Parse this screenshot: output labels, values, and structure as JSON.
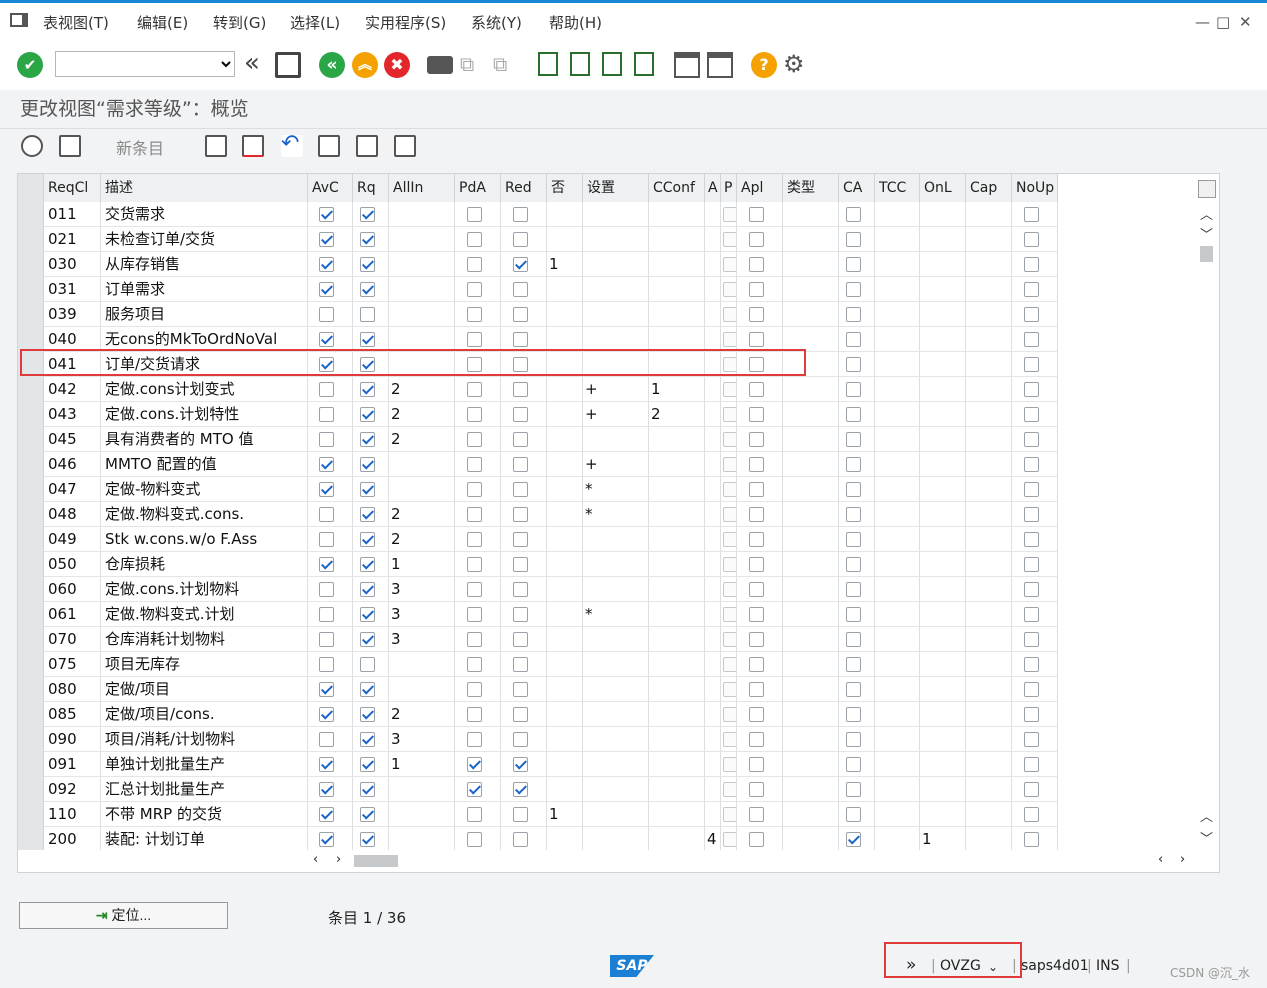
{
  "menu": {
    "items": [
      "表视图(T)",
      "编辑(E)",
      "转到(G)",
      "选择(L)",
      "实用程序(S)",
      "系统(Y)",
      "帮助(H)"
    ]
  },
  "window": {
    "minimize": "—",
    "maximize": "□",
    "close": "✕"
  },
  "title": "更改视图“需求等级”：概览",
  "app_toolbar": {
    "new_entries": "新条目"
  },
  "table": {
    "columns": [
      "ReqCl",
      "描述",
      "AvC",
      "Rq",
      "AllIn",
      "PdA",
      "Red",
      "否",
      "设置",
      "CConf",
      "A",
      "P",
      "Apl",
      "类型",
      "CA",
      "TCC",
      "OnL",
      "Cap",
      "NoUp"
    ],
    "rows": [
      {
        "reqcl": "011",
        "desc": "交货需求",
        "avc": true,
        "rq": true,
        "allin": "",
        "pda": false,
        "red": false,
        "no": "",
        "set": "",
        "cconf": "",
        "a": "",
        "p": false,
        "apl": false,
        "ca": false,
        "onl": "",
        "noup": false
      },
      {
        "reqcl": "021",
        "desc": "未检查订单/交货",
        "avc": true,
        "rq": true,
        "allin": "",
        "pda": false,
        "red": false,
        "no": "",
        "set": "",
        "cconf": "",
        "a": "",
        "p": false,
        "apl": false,
        "ca": false,
        "onl": "",
        "noup": false
      },
      {
        "reqcl": "030",
        "desc": "从库存销售",
        "avc": true,
        "rq": true,
        "allin": "",
        "pda": false,
        "red": true,
        "no": "1",
        "set": "",
        "cconf": "",
        "a": "",
        "p": false,
        "apl": false,
        "ca": false,
        "onl": "",
        "noup": false
      },
      {
        "reqcl": "031",
        "desc": "订单需求",
        "avc": true,
        "rq": true,
        "allin": "",
        "pda": false,
        "red": false,
        "no": "",
        "set": "",
        "cconf": "",
        "a": "",
        "p": false,
        "apl": false,
        "ca": false,
        "onl": "",
        "noup": false
      },
      {
        "reqcl": "039",
        "desc": "服务项目",
        "avc": false,
        "rq": false,
        "allin": "",
        "pda": false,
        "red": false,
        "no": "",
        "set": "",
        "cconf": "",
        "a": "",
        "p": false,
        "apl": false,
        "ca": false,
        "onl": "",
        "noup": false
      },
      {
        "reqcl": "040",
        "desc": "无cons的MkToOrdNoVal",
        "avc": true,
        "rq": true,
        "allin": "",
        "pda": false,
        "red": false,
        "no": "",
        "set": "",
        "cconf": "",
        "a": "",
        "p": false,
        "apl": false,
        "ca": false,
        "onl": "",
        "noup": false
      },
      {
        "reqcl": "041",
        "desc": "订单/交货请求",
        "avc": true,
        "rq": true,
        "allin": "",
        "pda": false,
        "red": false,
        "no": "",
        "set": "",
        "cconf": "",
        "a": "",
        "p": false,
        "apl": false,
        "ca": false,
        "onl": "",
        "noup": false
      },
      {
        "reqcl": "042",
        "desc": "定做.cons计划变式",
        "avc": false,
        "rq": true,
        "allin": "2",
        "pda": false,
        "red": false,
        "no": "",
        "set": "+",
        "cconf": "1",
        "a": "",
        "p": false,
        "apl": false,
        "ca": false,
        "onl": "",
        "noup": false
      },
      {
        "reqcl": "043",
        "desc": "定做.cons.计划特性",
        "avc": false,
        "rq": true,
        "allin": "2",
        "pda": false,
        "red": false,
        "no": "",
        "set": "+",
        "cconf": "2",
        "a": "",
        "p": false,
        "apl": false,
        "ca": false,
        "onl": "",
        "noup": false
      },
      {
        "reqcl": "045",
        "desc": "具有消费者的 MTO 值",
        "avc": false,
        "rq": true,
        "allin": "2",
        "pda": false,
        "red": false,
        "no": "",
        "set": "",
        "cconf": "",
        "a": "",
        "p": false,
        "apl": false,
        "ca": false,
        "onl": "",
        "noup": false
      },
      {
        "reqcl": "046",
        "desc": "MMTO 配置的值",
        "avc": true,
        "rq": true,
        "allin": "",
        "pda": false,
        "red": false,
        "no": "",
        "set": "+",
        "cconf": "",
        "a": "",
        "p": false,
        "apl": false,
        "ca": false,
        "onl": "",
        "noup": false
      },
      {
        "reqcl": "047",
        "desc": "定做-物料变式",
        "avc": true,
        "rq": true,
        "allin": "",
        "pda": false,
        "red": false,
        "no": "",
        "set": "*",
        "cconf": "",
        "a": "",
        "p": false,
        "apl": false,
        "ca": false,
        "onl": "",
        "noup": false
      },
      {
        "reqcl": "048",
        "desc": "定做.物料变式.cons.",
        "avc": false,
        "rq": true,
        "allin": "2",
        "pda": false,
        "red": false,
        "no": "",
        "set": "*",
        "cconf": "",
        "a": "",
        "p": false,
        "apl": false,
        "ca": false,
        "onl": "",
        "noup": false
      },
      {
        "reqcl": "049",
        "desc": "Stk w.cons.w/o F.Ass",
        "avc": false,
        "rq": true,
        "allin": "2",
        "pda": false,
        "red": false,
        "no": "",
        "set": "",
        "cconf": "",
        "a": "",
        "p": false,
        "apl": false,
        "ca": false,
        "onl": "",
        "noup": false
      },
      {
        "reqcl": "050",
        "desc": "仓库损耗",
        "avc": true,
        "rq": true,
        "allin": "1",
        "pda": false,
        "red": false,
        "no": "",
        "set": "",
        "cconf": "",
        "a": "",
        "p": false,
        "apl": false,
        "ca": false,
        "onl": "",
        "noup": false
      },
      {
        "reqcl": "060",
        "desc": "定做.cons.计划物料",
        "avc": false,
        "rq": true,
        "allin": "3",
        "pda": false,
        "red": false,
        "no": "",
        "set": "",
        "cconf": "",
        "a": "",
        "p": false,
        "apl": false,
        "ca": false,
        "onl": "",
        "noup": false
      },
      {
        "reqcl": "061",
        "desc": "定做.物料变式.计划",
        "avc": false,
        "rq": true,
        "allin": "3",
        "pda": false,
        "red": false,
        "no": "",
        "set": "*",
        "cconf": "",
        "a": "",
        "p": false,
        "apl": false,
        "ca": false,
        "onl": "",
        "noup": false
      },
      {
        "reqcl": "070",
        "desc": "仓库消耗计划物料",
        "avc": false,
        "rq": true,
        "allin": "3",
        "pda": false,
        "red": false,
        "no": "",
        "set": "",
        "cconf": "",
        "a": "",
        "p": false,
        "apl": false,
        "ca": false,
        "onl": "",
        "noup": false
      },
      {
        "reqcl": "075",
        "desc": "项目无库存",
        "avc": false,
        "rq": false,
        "allin": "",
        "pda": false,
        "red": false,
        "no": "",
        "set": "",
        "cconf": "",
        "a": "",
        "p": false,
        "apl": false,
        "ca": false,
        "onl": "",
        "noup": false
      },
      {
        "reqcl": "080",
        "desc": "定做/项目",
        "avc": true,
        "rq": true,
        "allin": "",
        "pda": false,
        "red": false,
        "no": "",
        "set": "",
        "cconf": "",
        "a": "",
        "p": false,
        "apl": false,
        "ca": false,
        "onl": "",
        "noup": false
      },
      {
        "reqcl": "085",
        "desc": "定做/项目/cons.",
        "avc": true,
        "rq": true,
        "allin": "2",
        "pda": false,
        "red": false,
        "no": "",
        "set": "",
        "cconf": "",
        "a": "",
        "p": false,
        "apl": false,
        "ca": false,
        "onl": "",
        "noup": false
      },
      {
        "reqcl": "090",
        "desc": "项目/消耗/计划物料",
        "avc": false,
        "rq": true,
        "allin": "3",
        "pda": false,
        "red": false,
        "no": "",
        "set": "",
        "cconf": "",
        "a": "",
        "p": false,
        "apl": false,
        "ca": false,
        "onl": "",
        "noup": false
      },
      {
        "reqcl": "091",
        "desc": "单独计划批量生产",
        "avc": true,
        "rq": true,
        "allin": "1",
        "pda": true,
        "red": true,
        "no": "",
        "set": "",
        "cconf": "",
        "a": "",
        "p": false,
        "apl": false,
        "ca": false,
        "onl": "",
        "noup": false
      },
      {
        "reqcl": "092",
        "desc": "汇总计划批量生产",
        "avc": true,
        "rq": true,
        "allin": "",
        "pda": true,
        "red": true,
        "no": "",
        "set": "",
        "cconf": "",
        "a": "",
        "p": false,
        "apl": false,
        "ca": false,
        "onl": "",
        "noup": false
      },
      {
        "reqcl": "110",
        "desc": "不带 MRP 的交货",
        "avc": true,
        "rq": true,
        "allin": "",
        "pda": false,
        "red": false,
        "no": "1",
        "set": "",
        "cconf": "",
        "a": "",
        "p": false,
        "apl": false,
        "ca": false,
        "onl": "",
        "noup": false
      },
      {
        "reqcl": "200",
        "desc": "装配: 计划订单",
        "avc": true,
        "rq": true,
        "allin": "",
        "pda": false,
        "red": false,
        "no": "",
        "set": "",
        "cconf": "",
        "a": "4",
        "p": false,
        "apl": false,
        "ca": true,
        "onl": "1",
        "noup": false
      }
    ]
  },
  "footer": {
    "position_button": "定位...",
    "entry_info": "条目 1 / 36"
  },
  "status": {
    "transaction": "OVZG",
    "system": "saps4d01",
    "mode": "INS",
    "watermark": "CSDN @沉_水"
  }
}
